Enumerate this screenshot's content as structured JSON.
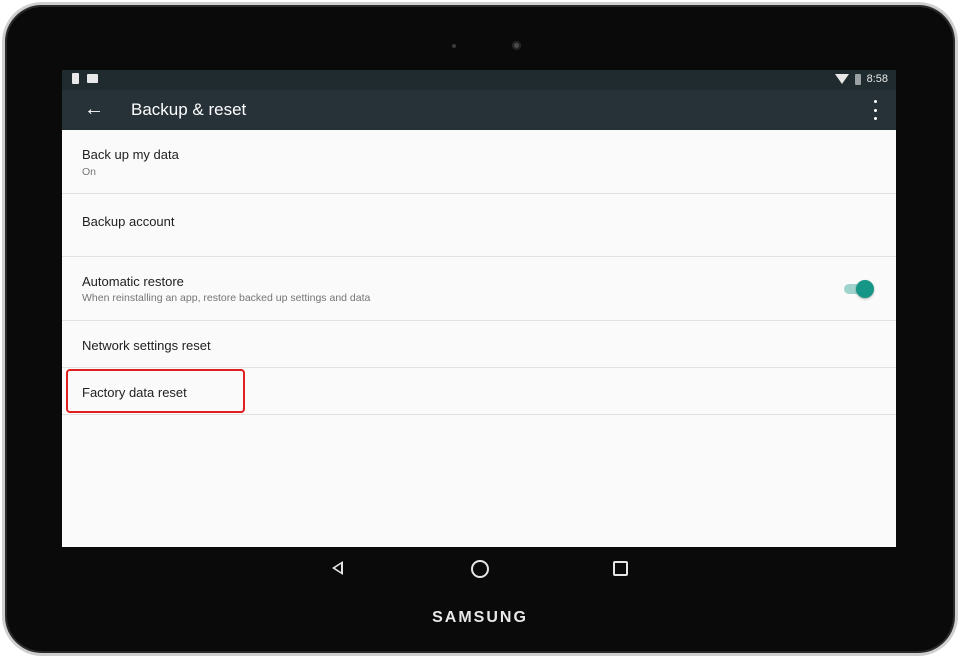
{
  "status_bar": {
    "time": "8:58"
  },
  "app_bar": {
    "title": "Backup & reset"
  },
  "settings": [
    {
      "title": "Back up my data",
      "summary": "On"
    },
    {
      "title": "Backup account"
    },
    {
      "title": "Automatic restore",
      "summary": "When reinstalling an app, restore backed up settings and data",
      "toggle_on": true
    },
    {
      "title": "Network settings reset"
    },
    {
      "title": "Factory data reset",
      "highlighted": true
    }
  ],
  "device": {
    "brand": "SAMSUNG"
  },
  "colors": {
    "app_bar": "#263238",
    "status_bar": "#1f2b2e",
    "toggle_accent": "#159686",
    "highlight": "#e01f1f"
  },
  "icons": [
    "back-arrow-icon",
    "overflow-menu-icon",
    "wifi-icon",
    "battery-icon",
    "nav-back-icon",
    "nav-home-icon",
    "nav-recents-icon"
  ]
}
